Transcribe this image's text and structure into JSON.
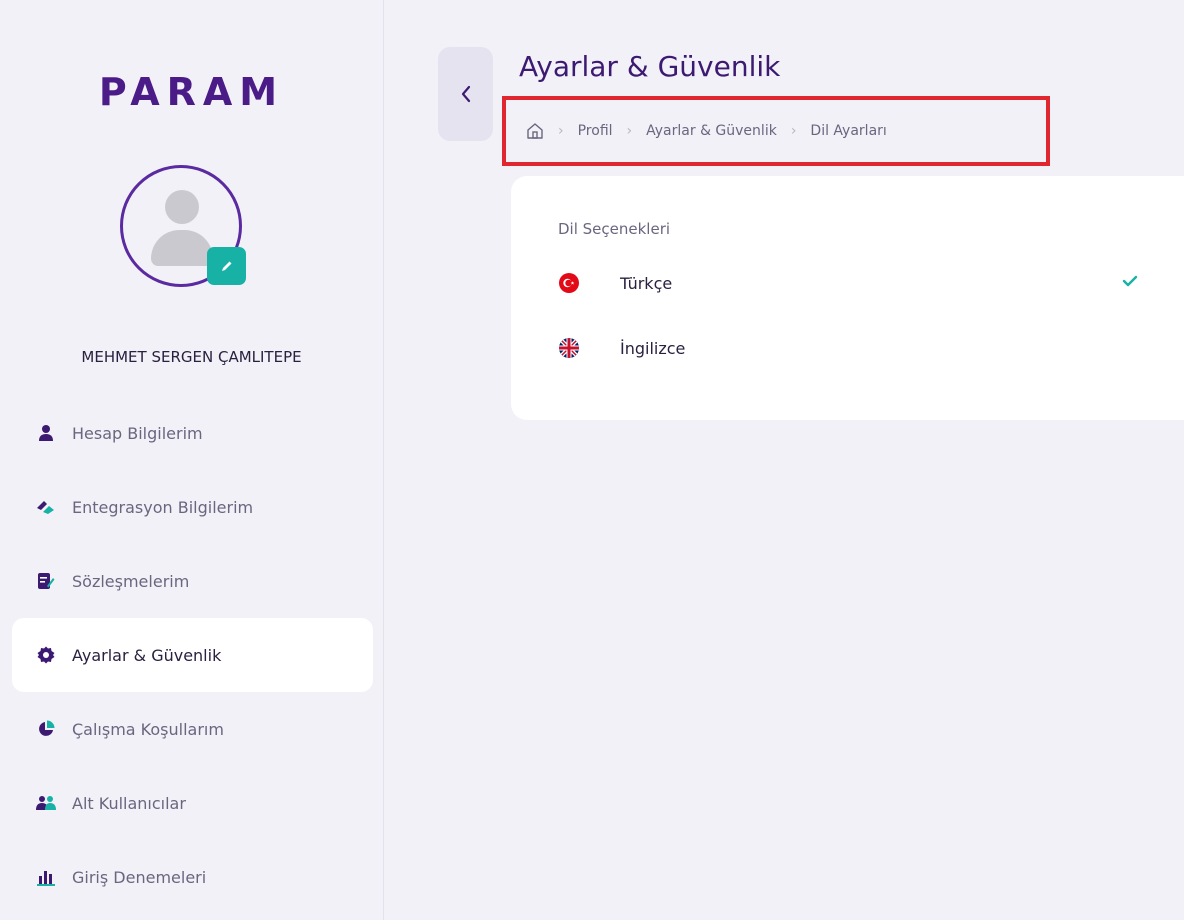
{
  "brand": {
    "logo_text": "PARAM"
  },
  "user": {
    "name": "MEHMET SERGEN ÇAMLITEPE"
  },
  "sidebar": {
    "items": [
      {
        "label": "Hesap Bilgilerim",
        "icon": "user-icon"
      },
      {
        "label": "Entegrasyon Bilgilerim",
        "icon": "integration-icon"
      },
      {
        "label": "Sözleşmelerim",
        "icon": "contract-icon"
      },
      {
        "label": "Ayarlar & Güvenlik",
        "icon": "gear-icon",
        "active": true
      },
      {
        "label": "Çalışma Koşullarım",
        "icon": "pie-chart-icon"
      },
      {
        "label": "Alt Kullanıcılar",
        "icon": "users-icon"
      },
      {
        "label": "Giriş Denemeleri",
        "icon": "bar-chart-icon"
      }
    ]
  },
  "header": {
    "title": "Ayarlar & Güvenlik",
    "breadcrumb": [
      "Profil",
      "Ayarlar & Güvenlik",
      "Dil Ayarları"
    ]
  },
  "languages": {
    "section_title": "Dil Seçenekleri",
    "options": [
      {
        "label": "Türkçe",
        "flag": "turkey-flag-icon",
        "selected": true
      },
      {
        "label": "İngilizce",
        "flag": "uk-flag-icon",
        "selected": false
      }
    ]
  },
  "colors": {
    "brand": "#4b1b87",
    "accent_teal": "#17b2a5",
    "highlight_red": "#e0262f",
    "background": "#f2f1f7"
  }
}
